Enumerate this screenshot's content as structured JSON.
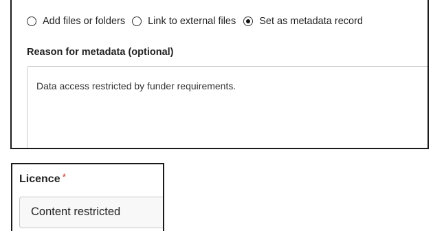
{
  "upload_mode": {
    "options": [
      {
        "label": "Add files or folders",
        "checked": false
      },
      {
        "label": "Link to external files",
        "checked": false
      },
      {
        "label": "Set as metadata record",
        "checked": true
      }
    ]
  },
  "reason": {
    "label": "Reason for metadata (optional)",
    "value": "Data access restricted by funder requirements."
  },
  "licence": {
    "label": "Licence",
    "required_marker": "*",
    "selected": "Content restricted"
  },
  "colors": {
    "panel_border": "#1a1a1a",
    "field_border": "#c8c8c8",
    "required": "#c0392b"
  }
}
